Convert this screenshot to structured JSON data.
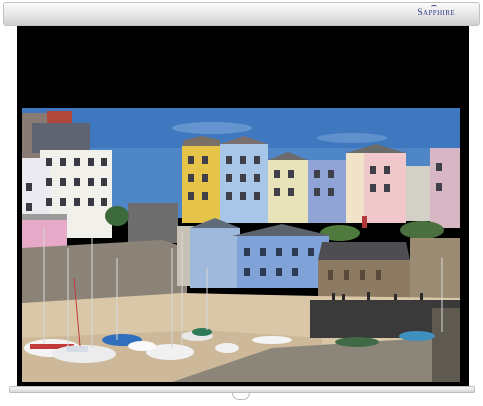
{
  "brand": {
    "name": "Sapphire",
    "accent_color": "#2b3a8c"
  },
  "screen": {
    "frame_color": "#000000",
    "casing_color": "#e6e6e6",
    "image_subject": "harbour-town"
  },
  "icons": {
    "pull_handle": "pull-ring-icon"
  }
}
